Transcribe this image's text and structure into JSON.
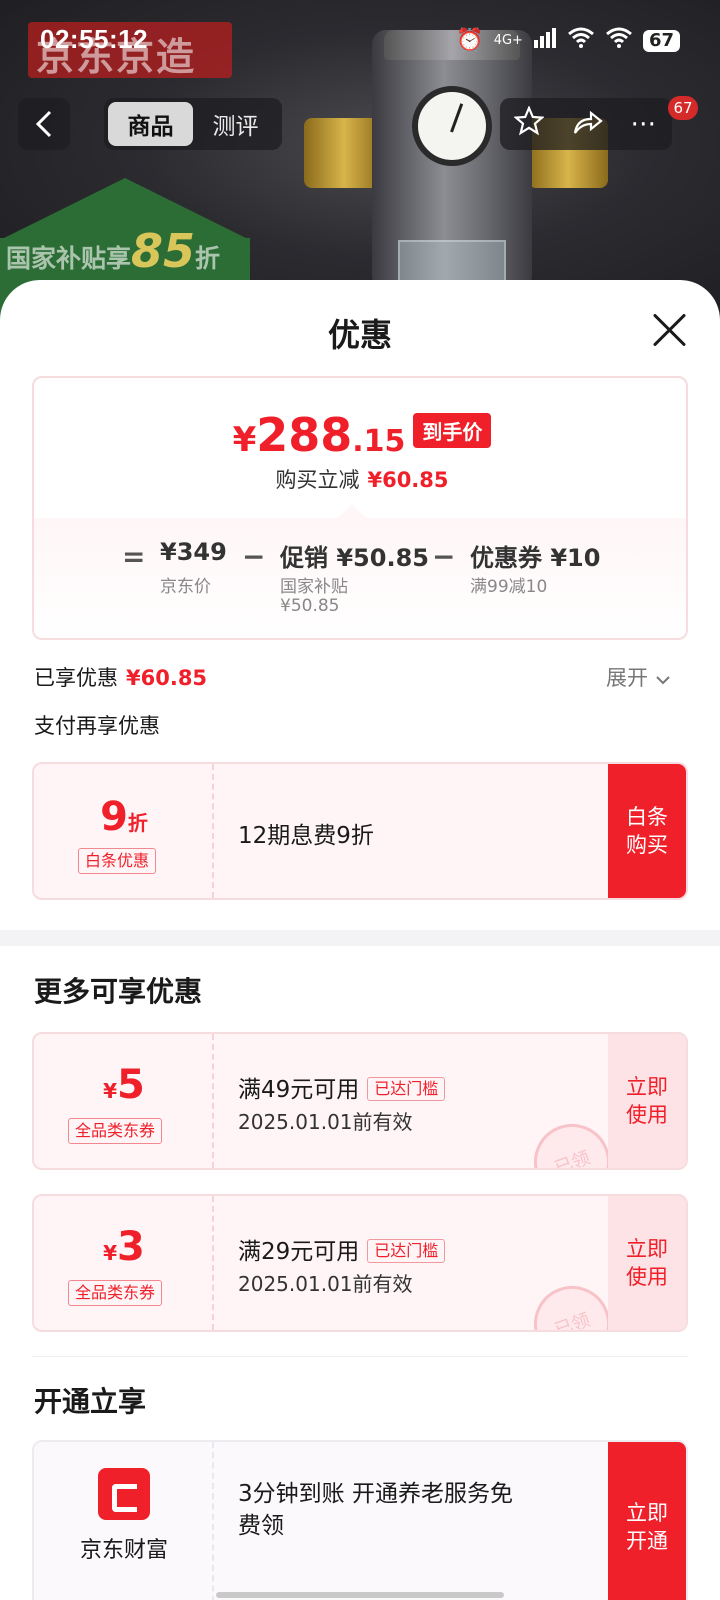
{
  "status_bar": {
    "time": "02:55:12",
    "network": "4G+",
    "battery": "67"
  },
  "backdrop": {
    "logo_text": "京东京造",
    "subsidy_prefix": "国家补贴享",
    "subsidy_number": "85",
    "subsidy_suffix": "折"
  },
  "nav": {
    "tabs": [
      {
        "label": "商品",
        "active": true
      },
      {
        "label": "测评",
        "active": false
      }
    ],
    "badge_count": "67"
  },
  "sheet": {
    "title": "优惠",
    "price": {
      "yen": "¥",
      "integer": "288",
      "decimal": ".15",
      "tag": "到手价",
      "reduce_label": "购买立减",
      "reduce_amount": "¥60.85",
      "breakdown": {
        "eq": "=",
        "minus": "−",
        "base_value": "¥349",
        "base_label": "京东价",
        "promo_value": "促销 ¥50.85",
        "promo_label": "国家补贴",
        "promo_amount": "¥50.85",
        "coupon_value": "优惠券 ¥10",
        "coupon_label": "满99减10"
      }
    },
    "enjoyed_label": "已享优惠",
    "enjoyed_amount": "¥60.85",
    "expand_label": "展开",
    "pay_more_label": "支付再享优惠",
    "payment_offer": {
      "value": "9",
      "unit": "折",
      "tag": "白条优惠",
      "desc": "12期息费9折",
      "cta_line1": "白条",
      "cta_line2": "购买"
    },
    "more_title": "更多可享优惠",
    "coupons": [
      {
        "unit": "¥",
        "value": "5",
        "tag": "全品类东券",
        "condition": "满49元可用",
        "threshold": "已达门槛",
        "validity": "2025.01.01前有效",
        "cta_line1": "立即",
        "cta_line2": "使用",
        "stamp": "已领"
      },
      {
        "unit": "¥",
        "value": "3",
        "tag": "全品类东券",
        "condition": "满29元可用",
        "threshold": "已达门槛",
        "validity": "2025.01.01前有效",
        "cta_line1": "立即",
        "cta_line2": "使用",
        "stamp": "已领"
      }
    ],
    "open_title": "开通立享",
    "open_offer": {
      "brand": "京东财富",
      "desc_line1": "3分钟到账 开通养老服务免",
      "desc_line2": "费领",
      "cta_line1": "立即",
      "cta_line2": "开通"
    }
  },
  "colors": {
    "accent": "#f0202b",
    "soft_accent": "#fde3e6",
    "card_border": "#f7dcdf"
  }
}
